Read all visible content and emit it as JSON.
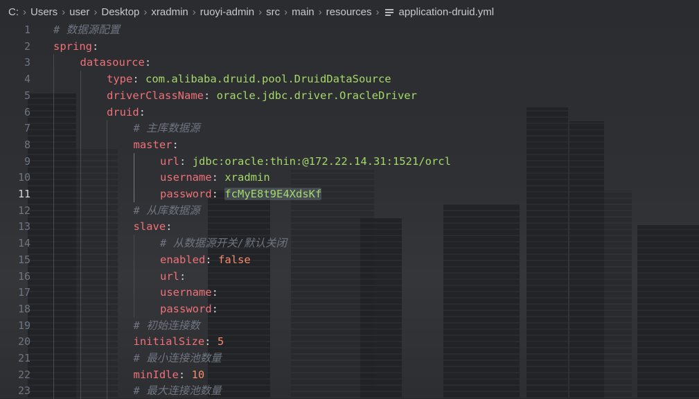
{
  "breadcrumb": {
    "parts": [
      "C:",
      "Users",
      "user",
      "Desktop",
      "xradmin",
      "ruoyi-admin",
      "src",
      "main",
      "resources"
    ],
    "file": "application-druid.yml",
    "file_icon": "lines-file-icon"
  },
  "editor": {
    "active_line": 11,
    "lines": [
      {
        "n": "1",
        "indent": 0,
        "comment": "# 数据源配置"
      },
      {
        "n": "2",
        "indent": 0,
        "key": "spring"
      },
      {
        "n": "3",
        "indent": 1,
        "key": "datasource"
      },
      {
        "n": "4",
        "indent": 2,
        "key": "type",
        "value": "com.alibaba.druid.pool.DruidDataSource"
      },
      {
        "n": "5",
        "indent": 2,
        "key": "driverClassName",
        "value": "oracle.jdbc.driver.OracleDriver"
      },
      {
        "n": "6",
        "indent": 2,
        "key": "druid"
      },
      {
        "n": "7",
        "indent": 3,
        "comment": "# 主库数据源"
      },
      {
        "n": "8",
        "indent": 3,
        "key": "master"
      },
      {
        "n": "9",
        "indent": 4,
        "key": "url",
        "value": "jdbc:oracle:thin:@172.22.14.31:1521/orcl"
      },
      {
        "n": "10",
        "indent": 4,
        "key": "username",
        "value": "xradmin"
      },
      {
        "n": "11",
        "indent": 4,
        "key": "password",
        "value": "fcMyE8t9E4XdsKf",
        "highlight": true
      },
      {
        "n": "12",
        "indent": 3,
        "comment": "# 从库数据源"
      },
      {
        "n": "13",
        "indent": 3,
        "key": "slave"
      },
      {
        "n": "14",
        "indent": 4,
        "comment": "# 从数据源开关/默认关闭"
      },
      {
        "n": "15",
        "indent": 4,
        "key": "enabled",
        "value": "false",
        "vtype": "bool"
      },
      {
        "n": "16",
        "indent": 4,
        "key": "url"
      },
      {
        "n": "17",
        "indent": 4,
        "key": "username"
      },
      {
        "n": "18",
        "indent": 4,
        "key": "password"
      },
      {
        "n": "19",
        "indent": 3,
        "comment": "# 初始连接数"
      },
      {
        "n": "20",
        "indent": 3,
        "key": "initialSize",
        "value": "5",
        "vtype": "num"
      },
      {
        "n": "21",
        "indent": 3,
        "comment": "# 最小连接池数量"
      },
      {
        "n": "22",
        "indent": 3,
        "key": "minIdle",
        "value": "10",
        "vtype": "num"
      },
      {
        "n": "23",
        "indent": 3,
        "comment": "# 最大连接池数量"
      }
    ]
  },
  "colors": {
    "key": "#f07178",
    "string": "#a6d96a",
    "number": "#f78c6c",
    "comment": "#6f7580",
    "line_number": "#6e7681"
  }
}
